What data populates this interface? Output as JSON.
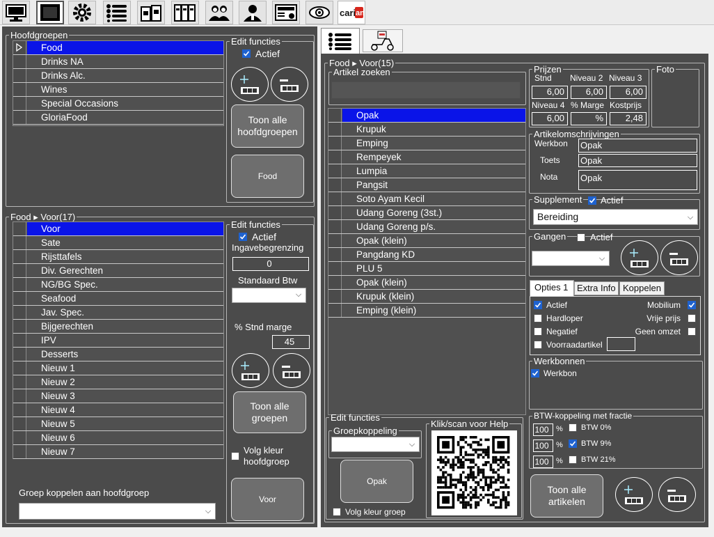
{
  "toolbar": {
    "icons": [
      "monitor-icon",
      "screen-icon",
      "gear-icon",
      "list-icon",
      "files-icon",
      "binders-icon",
      "users-icon",
      "manager-icon",
      "invoice-icon",
      "eye-icon",
      "carian-logo"
    ],
    "logo_text": "carian"
  },
  "left": {
    "hoofdgroepen": {
      "title": "Hoofdgroepen",
      "items": [
        "Food",
        "Drinks NA",
        "Drinks Alc.",
        "Wines",
        "Special Occasions",
        "GloriaFood"
      ],
      "selected": "Food"
    },
    "edit1": {
      "title": "Edit functies",
      "actief_label": "Actief",
      "actief_checked": true,
      "show_all_label": "Toon alle hoofdgroepen",
      "current_button_label": "Food"
    },
    "groepen": {
      "title": "Food ▸ Voor(17)",
      "items": [
        "Voor",
        "Sate",
        "Rijsttafels",
        "Div. Gerechten",
        "NG/BG Spec.",
        "Seafood",
        "Jav. Spec.",
        "Bijgerechten",
        "IPV",
        "Desserts",
        "Nieuw 1",
        "Nieuw 2",
        "Nieuw 3",
        "Nieuw 4",
        "Nieuw 5",
        "Nieuw 6",
        "Nieuw 7"
      ],
      "selected": "Voor"
    },
    "edit2": {
      "title": "Edit functies",
      "actief_label": "Actief",
      "actief_checked": true,
      "ingave_label": "Ingavebegrenzing",
      "ingave_value": "0",
      "btw_label": "Standaard Btw",
      "btw_value": "",
      "marge_label": "% Stnd marge",
      "marge_value": "45",
      "show_all_label": "Toon alle groepen",
      "volg_kleur_label": "Volg kleur hoofdgroep",
      "volg_kleur_checked": false,
      "current_button_label": "Voor"
    },
    "koppel": {
      "label": "Groep koppelen aan hoofdgroep",
      "value": ""
    }
  },
  "right": {
    "tabs": [
      "list-icon",
      "delivery-scooter-icon"
    ],
    "title": "Food ▸ Voor(15)",
    "search": {
      "title": "Artikel zoeken",
      "value": ""
    },
    "artikelen": {
      "items": [
        "Opak",
        "Krupuk",
        "Emping",
        "Rempeyek",
        "Lumpia",
        "Pangsit",
        "Soto Ayam Kecil",
        "Udang Goreng (3st.)",
        "Udang Goreng p/s.",
        "Opak (klein)",
        "Pangdang KD",
        "PLU 5",
        "Opak (klein)",
        "Krupuk (klein)",
        "Emping (klein)"
      ],
      "selected": "Opak"
    },
    "prijzen": {
      "title": "Prijzen",
      "labels": [
        "Stnd",
        "Niveau 2",
        "Niveau 3",
        "Niveau 4",
        "% Marge",
        "Kostprijs"
      ],
      "values": [
        "6,00",
        "6,00",
        "6,00",
        "6,00",
        "%",
        "2,48"
      ]
    },
    "foto": {
      "title": "Foto"
    },
    "omschrijving": {
      "title": "Artikelomschrijvingen",
      "werkbon_label": "Werkbon",
      "werkbon_value": "Opak",
      "toets_label": "Toets",
      "toets_value": "Opak",
      "nota_label": "Nota",
      "nota_value": "Opak"
    },
    "supplement": {
      "title": "Supplement",
      "actief_label": "Actief",
      "actief_checked": true,
      "value": "Bereiding"
    },
    "gangen": {
      "title": "Gangen",
      "actief_label": "Actief",
      "actief_checked": false,
      "value": ""
    },
    "opties": {
      "tabs": [
        "Opties 1",
        "Extra Info",
        "Koppelen"
      ],
      "active_tab": "Opties 1",
      "left": [
        {
          "label": "Actief",
          "checked": true
        },
        {
          "label": "Hardloper",
          "checked": false
        },
        {
          "label": "Negatief",
          "checked": false
        },
        {
          "label": "Voorraadartikel",
          "checked": false
        }
      ],
      "right": [
        {
          "label": "Mobilium",
          "checked": true
        },
        {
          "label": "Vrije prijs",
          "checked": false
        },
        {
          "label": "Geen  omzet",
          "checked": false
        }
      ],
      "voorraad_value": ""
    },
    "werkbonnen": {
      "title": "Werkbonnen",
      "item_label": "Werkbon",
      "item_checked": true
    },
    "btw": {
      "title": "BTW-koppeling met fractie",
      "rows": [
        {
          "fraction": "100",
          "unit": "%",
          "label": "BTW  0%",
          "checked": false
        },
        {
          "fraction": "100",
          "unit": "%",
          "label": "BTW   9%",
          "checked": true
        },
        {
          "fraction": "100",
          "unit": "%",
          "label": "BTW 21%",
          "checked": false
        }
      ]
    },
    "edit": {
      "title": "Edit functies",
      "groepkoppeling_title": "Groepkoppeling",
      "groepkoppeling_value": "",
      "current_button_label": "Opak",
      "volg_kleur_label": "Volg kleur groep",
      "volg_kleur_checked": false,
      "help_title": "Klik/scan voor Help"
    },
    "show_all_label": "Toon alle artikelen"
  },
  "colors": {
    "panel": "#4b4b4b",
    "selection": "#0a14e8",
    "checkbox_on": "#1e62d0"
  }
}
